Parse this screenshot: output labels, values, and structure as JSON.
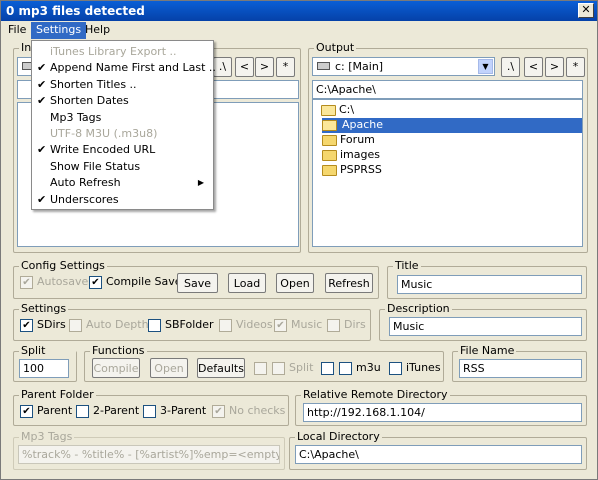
{
  "window": {
    "title": "0 mp3 files detected",
    "close_glyph": "✕"
  },
  "menubar": {
    "file": "File",
    "settings": "Settings",
    "help": "Help"
  },
  "settings_menu": {
    "items": [
      {
        "label": "iTunes Library Export ..",
        "checked": false,
        "enabled": false
      },
      {
        "label": "Append Name First and Last ..",
        "checked": true,
        "enabled": true
      },
      {
        "label": "Shorten Titles ..",
        "checked": true,
        "enabled": true
      },
      {
        "label": "Shorten Dates",
        "checked": true,
        "enabled": true
      },
      {
        "label": "Mp3 Tags",
        "checked": false,
        "enabled": true
      },
      {
        "label": "UTF-8 M3U (.m3u8)",
        "checked": false,
        "enabled": false
      },
      {
        "label": "Write Encoded URL",
        "checked": true,
        "enabled": true
      },
      {
        "label": "Show File Status",
        "checked": false,
        "enabled": true
      },
      {
        "label": "Auto Refresh",
        "checked": false,
        "enabled": true,
        "submenu": true
      },
      {
        "label": "Underscores",
        "checked": true,
        "enabled": true
      }
    ],
    "check_glyph": "✔",
    "submenu_glyph": "▶"
  },
  "input": {
    "title_partial": "In",
    "nav_buttons": [
      ".\\",
      "<",
      ">",
      "*"
    ]
  },
  "output": {
    "title": "Output",
    "drive": "c: [Main]",
    "nav_buttons": [
      ".\\",
      "<",
      ">",
      "*"
    ],
    "path": "C:\\Apache\\",
    "tree": [
      "C:\\",
      "Apache",
      "Forum",
      "images",
      "PSPRSS"
    ]
  },
  "config_settings": {
    "title": "Config Settings",
    "autosave": "Autosave",
    "compile_save": "Compile Save",
    "save": "Save",
    "load": "Load",
    "open": "Open",
    "refresh": "Refresh"
  },
  "title_group": {
    "title": "Title",
    "value": "Music"
  },
  "settings_group": {
    "title": "Settings",
    "sdirs": "SDirs",
    "auto_depth": "Auto Depth",
    "sbfolder": "SBFolder",
    "videos": "Videos",
    "music": "Music",
    "dirs": "Dirs"
  },
  "description_group": {
    "title": "Description",
    "value": "Music"
  },
  "split_after": {
    "title": "Split After",
    "value": "100"
  },
  "functions": {
    "title": "Functions",
    "compile": "Compile",
    "open": "Open",
    "defaults": "Defaults",
    "split": "Split",
    "m3u": "m3u",
    "itunes": "iTunes"
  },
  "file_name": {
    "title": "File Name",
    "value": "RSS"
  },
  "parent_folder": {
    "title": "Parent Folder",
    "parent": "Parent",
    "two_parent": "2-Parent",
    "three_parent": "3-Parent",
    "no_checks": "No checks"
  },
  "relative_remote": {
    "title": "Relative Remote Directory",
    "value": "http://192.168.1.104/"
  },
  "mp3_tags": {
    "title": "Mp3 Tags",
    "value": "%track% - %title% - [%artist%]%emp=<empty tag>%"
  },
  "local_directory": {
    "title": "Local Directory",
    "value": "C:\\Apache\\"
  },
  "check_mark": "✔"
}
